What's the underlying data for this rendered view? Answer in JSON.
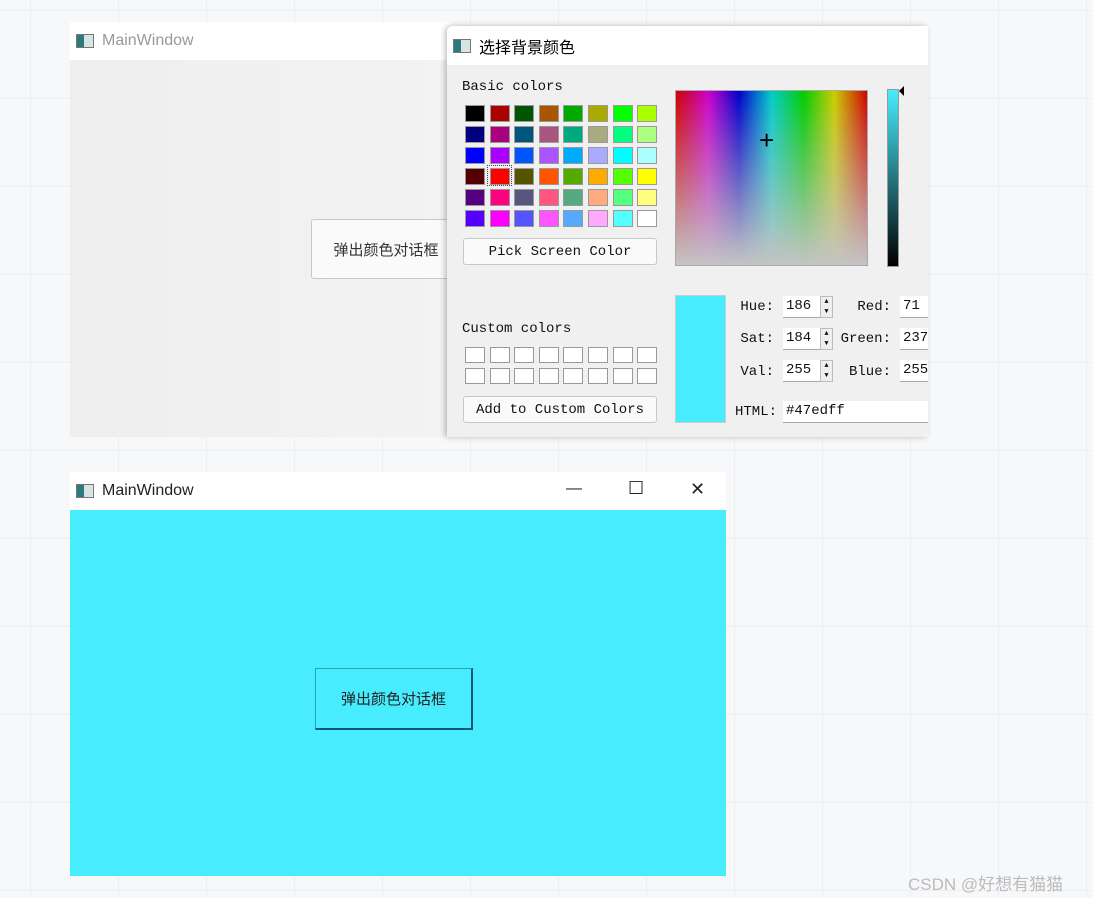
{
  "top_window": {
    "title": "MainWindow",
    "button_label": "弹出颜色对话框"
  },
  "dialog": {
    "title": "选择背景颜色",
    "basic_colors_label": "Basic colors",
    "basic_colors": [
      "#000000",
      "#aa0000",
      "#005500",
      "#aa5500",
      "#00aa00",
      "#aaaa00",
      "#00ff00",
      "#aaff00",
      "#00007f",
      "#aa007f",
      "#00557f",
      "#aa557f",
      "#00aa7f",
      "#aaaa7f",
      "#00ff7f",
      "#aaff7f",
      "#0000ff",
      "#aa00ff",
      "#0055ff",
      "#aa55ff",
      "#00aaff",
      "#aaaaff",
      "#00ffff",
      "#aaffff",
      "#550000",
      "#ff0000",
      "#555500",
      "#ff5500",
      "#55aa00",
      "#ffaa00",
      "#55ff00",
      "#ffff00",
      "#55007f",
      "#ff007f",
      "#55557f",
      "#ff557f",
      "#55aa7f",
      "#ffaa7f",
      "#55ff7f",
      "#ffff7f",
      "#5500ff",
      "#ff00ff",
      "#5555ff",
      "#ff55ff",
      "#55aaff",
      "#ffaaff",
      "#55ffff",
      "#ffffff"
    ],
    "pick_screen_color": "Pick Screen Color",
    "custom_colors_label": "Custom colors",
    "add_custom": "Add to Custom Colors",
    "current_color": "#47edff",
    "fields": {
      "hue_label": "Hue:",
      "hue": "186",
      "sat_label": "Sat:",
      "sat": "184",
      "val_label": "Val:",
      "val": "255",
      "red_label": "Red:",
      "red": "71",
      "green_label": "Green:",
      "green": "237",
      "blue_label": "Blue:",
      "blue": "255",
      "html_label": "HTML:",
      "html": "#47edff"
    }
  },
  "bottom_window": {
    "title": "MainWindow",
    "button_label": "弹出颜色对话框",
    "background": "#47edff",
    "minimize": "—",
    "maximize": "☐",
    "close": "✕"
  },
  "watermark": "CSDN @好想有猫猫"
}
